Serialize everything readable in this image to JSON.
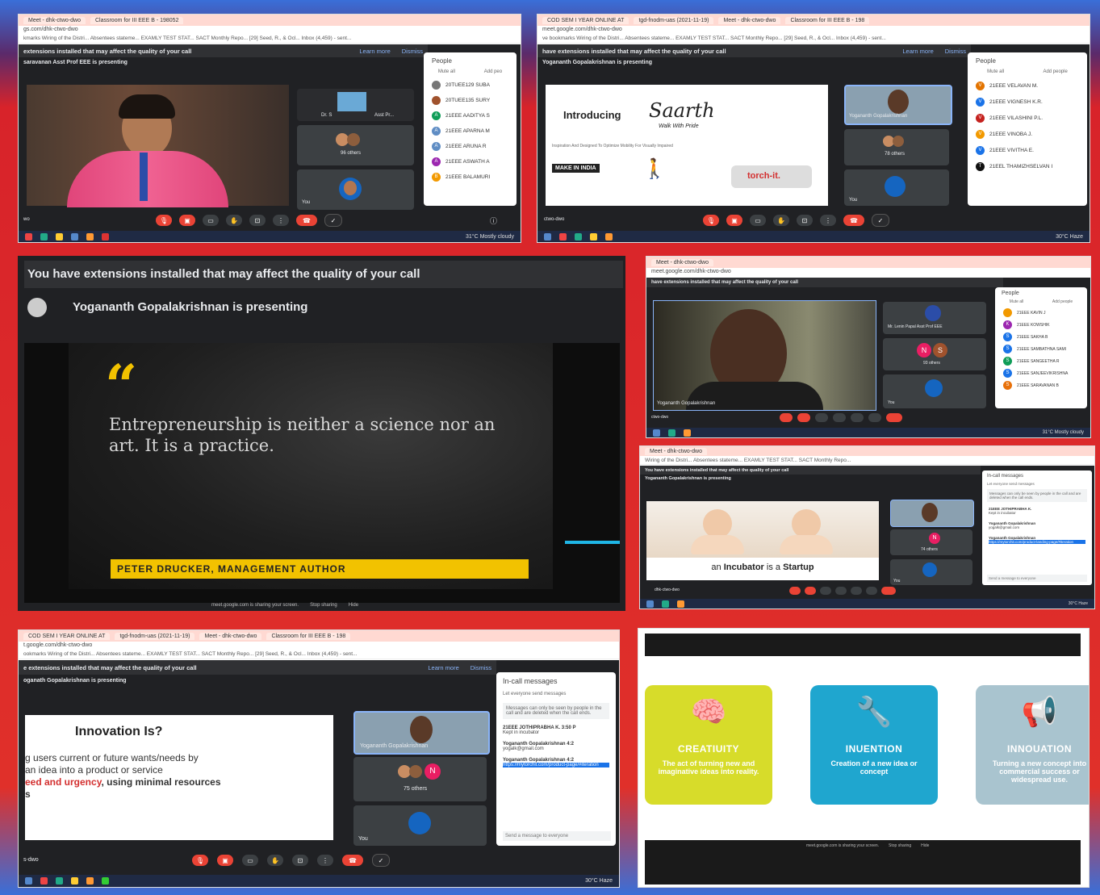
{
  "collage": {
    "p1": {
      "tabs": [
        "Meet - dhk-ctwo-dwo",
        "Classroom for III EEE B - 198052"
      ],
      "address": "gs.com/dhk-ctwo-dwo",
      "bookmarks": "kmarks   Wiring of the Distri...   Absentees stateme...   EXAMLY TEST STAT...   SACT Monthly Repo...   [29] Seed, R., & Ocl...   Inbox (4,459) - sent...",
      "warning": "extensions installed that may affect the quality of your call",
      "learn_more": "Learn more",
      "dismiss": "Dismiss",
      "presenting": "saravanan Asst Prof EEE is presenting",
      "tile_name": "Dr. S",
      "tile_name_2": "Asst Pr...",
      "others": "96 others",
      "you": "You",
      "people_title": "People",
      "mute_all": "Mute all",
      "add_people": "Add peo",
      "meeting_code": "wo",
      "weather": "31°C  Mostly cloudy",
      "people": [
        {
          "initial": "",
          "name": "20TUEE129 SUBA",
          "color": "#777"
        },
        {
          "initial": "",
          "name": "20TUEE135 SURY",
          "color": "#a0522d"
        },
        {
          "initial": "A",
          "name": "21EEE AADITYA S",
          "color": "#0f9d58"
        },
        {
          "initial": "A",
          "name": "21EEE APARNA M",
          "color": "#5f8dc4"
        },
        {
          "initial": "A",
          "name": "21EEE ARUNA R",
          "color": "#5f8dc4"
        },
        {
          "initial": "A",
          "name": "21EEE ASWATH A",
          "color": "#9c27b0"
        },
        {
          "initial": "B",
          "name": "21EEE BALAMURI",
          "color": "#f29900"
        }
      ]
    },
    "p2": {
      "tabs": [
        "COD SEM I YEAR ONLINE AT",
        "tgd-fnodm-uas (2021-11-19)",
        "Meet - dhk-ctwo-dwo",
        "Classroom for III EEE B - 198"
      ],
      "address": "meet.google.com/dhk-ctwo-dwo",
      "bookmarks": "ve bookmarks   Wiring of the Distri...   Absentees stateme...   EXAMLY TEST STAT...   SACT Monthly Repo...   [29] Seed, R., & Ocl...   Inbox (4,459) - sent...",
      "warning": "have extensions installed that may affect the quality of your call",
      "learn_more": "Learn more",
      "dismiss": "Dismiss",
      "presenting": "Yogananth Gopalakrishnan is presenting",
      "slide_intro": "Introducing",
      "slide_brand": "Saarth",
      "slide_tagline": "Walk With Pride",
      "slide_sub": "Inspiration And Designed To Optimize Mobility For Visually Impaired",
      "slide_make": "MAKE IN INDIA",
      "slide_torch": "torch-it.",
      "tile_name": "Yogananth Gopalakrishnan",
      "others": "78 others",
      "you": "You",
      "people_title": "People",
      "mute_all": "Mute all",
      "add_people": "Add people",
      "meeting_code": "ctwo-dwo",
      "weather": "30°C  Haze",
      "people": [
        {
          "initial": "V",
          "name": "21EEE VELAVAN M.",
          "color": "#e37400"
        },
        {
          "initial": "V",
          "name": "21EEE VIGNESH K.R.",
          "color": "#1a73e8"
        },
        {
          "initial": "V",
          "name": "21EEE VILASHINI P.L.",
          "color": "#c5221f"
        },
        {
          "initial": "V",
          "name": "21EEE VINOBA J.",
          "color": "#f29900"
        },
        {
          "initial": "V",
          "name": "21EEE VIVITHA E.",
          "color": "#1a73e8"
        },
        {
          "initial": "T",
          "name": "21EEL THAMIZHSELVAN I",
          "color": "#111"
        }
      ]
    },
    "p3": {
      "warning": "You have extensions installed that may affect the quality of your call",
      "presenting": "Yogananth Gopalakrishnan is presenting",
      "quote_mark": "“",
      "quote": "Entrepreneurship is neither a science nor an art. It is a practice.",
      "author": "PETER DRUCKER, MANAGEMENT AUTHOR",
      "sharing": "meet.google.com is sharing your screen.",
      "stop_sharing": "Stop sharing",
      "hide": "Hide"
    },
    "p4": {
      "address": "meet.google.com/dhk-ctwo-dwo",
      "warning": "have extensions installed that may affect the quality of your call",
      "tile_name": "Mr. Lenin Papal Asst Prof EEE",
      "others": "93 others",
      "presenter": "Yogananth Gopalakrishnan",
      "you": "You",
      "meeting_code": "ctwo-dwo",
      "weather": "31°C  Mostly cloudy",
      "people_title": "People",
      "mute_all": "Mute all",
      "add_people": "Add people",
      "tile_initials": [
        "N",
        "S"
      ],
      "people": [
        {
          "initial": "",
          "name": "21EEE KAVIN J",
          "color": "#f29900"
        },
        {
          "initial": "K",
          "name": "21EEE KOWSHIK",
          "color": "#9c27b0"
        },
        {
          "initial": "S",
          "name": "21EEE SAKHA B",
          "color": "#1a73e8"
        },
        {
          "initial": "S",
          "name": "21EEE SAMBATHNA SAMI",
          "color": "#1a73e8"
        },
        {
          "initial": "S",
          "name": "21EEE SANGEETHA R",
          "color": "#0f9d58"
        },
        {
          "initial": "S",
          "name": "21EEE SANJEEVIKRISHNA",
          "color": "#1a73e8"
        },
        {
          "initial": "S",
          "name": "21EEE SARAVANAN B",
          "color": "#e8710a"
        }
      ]
    },
    "p5": {
      "warning": "You have extensions installed that may affect the quality of your call",
      "presenting": "Yogananth Gopalakrishnan is presenting",
      "caption_pre": "an",
      "caption_b1": "Incubator",
      "caption_mid": "is a",
      "caption_b2": "Startup",
      "others": "74 others",
      "you": "You",
      "meeting_code": "dhk-ctwo-dwo",
      "chat_title": "In-call messages",
      "chat_let": "Let everyone send messages",
      "chat_note": "Messages can only be seen by people in the call and are deleted when the call ends.",
      "chat_msgs": [
        {
          "who": "21EEE JOTHIPRABHA K.",
          "text": "Kept in incubator"
        },
        {
          "who": "Yogananth Gopalakrishnan",
          "text": "yogalk@gmail.com"
        },
        {
          "who": "Yogananth Gopalakrishnan",
          "text": "https://mytorchit.com/product-landing-page/#iteration"
        }
      ],
      "chat_input": "Send a message to everyone",
      "weather": "30°C  Haze"
    },
    "p6": {
      "tabs": [
        "COD SEM I YEAR ONLINE AT",
        "tgd-fnodm-uas (2021-11-19)",
        "Meet - dhk-ctwo-dwo",
        "Classroom for III EEE B - 198"
      ],
      "address": "t.google.com/dhk-ctwo-dwo",
      "bookmarks": "ookmarks   Wiring of the Distri...   Absentees stateme...   EXAMLY TEST STAT...   SACT Monthly Repo...   [29] Seed, R., & Ocl...   Inbox (4,459) - sent...",
      "warning": "e extensions installed that may affect the quality of your call",
      "learn_more": "Learn more",
      "dismiss": "Dismiss",
      "presenting": "oganath Gopalakrishnan is presenting",
      "slide_title": "Innovation Is?",
      "slide_line1": "g users current or future wants/needs by",
      "slide_line2": "an idea into a product or service",
      "slide_line3_red": "eed and urgency",
      "slide_line3_rest": ", using minimal resources",
      "slide_line4": "s",
      "tile_name": "Yogananth Gopalakrishnan",
      "others": "75 others",
      "you": "You",
      "meeting_code": "s-dwo",
      "weather": "30°C  Haze",
      "chat_title": "In-call messages",
      "chat_let": "Let everyone send messages",
      "chat_note": "Messages can only be seen by people in the call and are deleted when the call ends.",
      "chat_msgs": [
        {
          "who": "21EEE JOTHIPRABHA K.",
          "time": "3:50 P",
          "text": "Kept in incubator"
        },
        {
          "who": "Yogananth Gopalakrishnan",
          "time": "4:2",
          "text": "yogalk@gmail.com"
        },
        {
          "who": "Yogananth Gopalakrishnan",
          "time": "4:2",
          "text": "https://mytorchit.com/product-page/#iteration"
        }
      ],
      "chat_input": "Send a message to everyone"
    },
    "p7": {
      "cards": [
        {
          "title": "CREATIUITY",
          "text": "The act of turning new and imaginative ideas into reality.",
          "color": "#d7dc2a"
        },
        {
          "title": "INUENTION",
          "text": "Creation of a new idea or concept",
          "color": "#1fa6cf"
        },
        {
          "title": "INNOUATION",
          "text": "Turning a new concept into commercial success or widespread use.",
          "color": "#a9c4cf"
        }
      ],
      "sharing": "meet.google.com is sharing your screen.",
      "stop_sharing": "Stop sharing",
      "hide": "Hide"
    }
  }
}
